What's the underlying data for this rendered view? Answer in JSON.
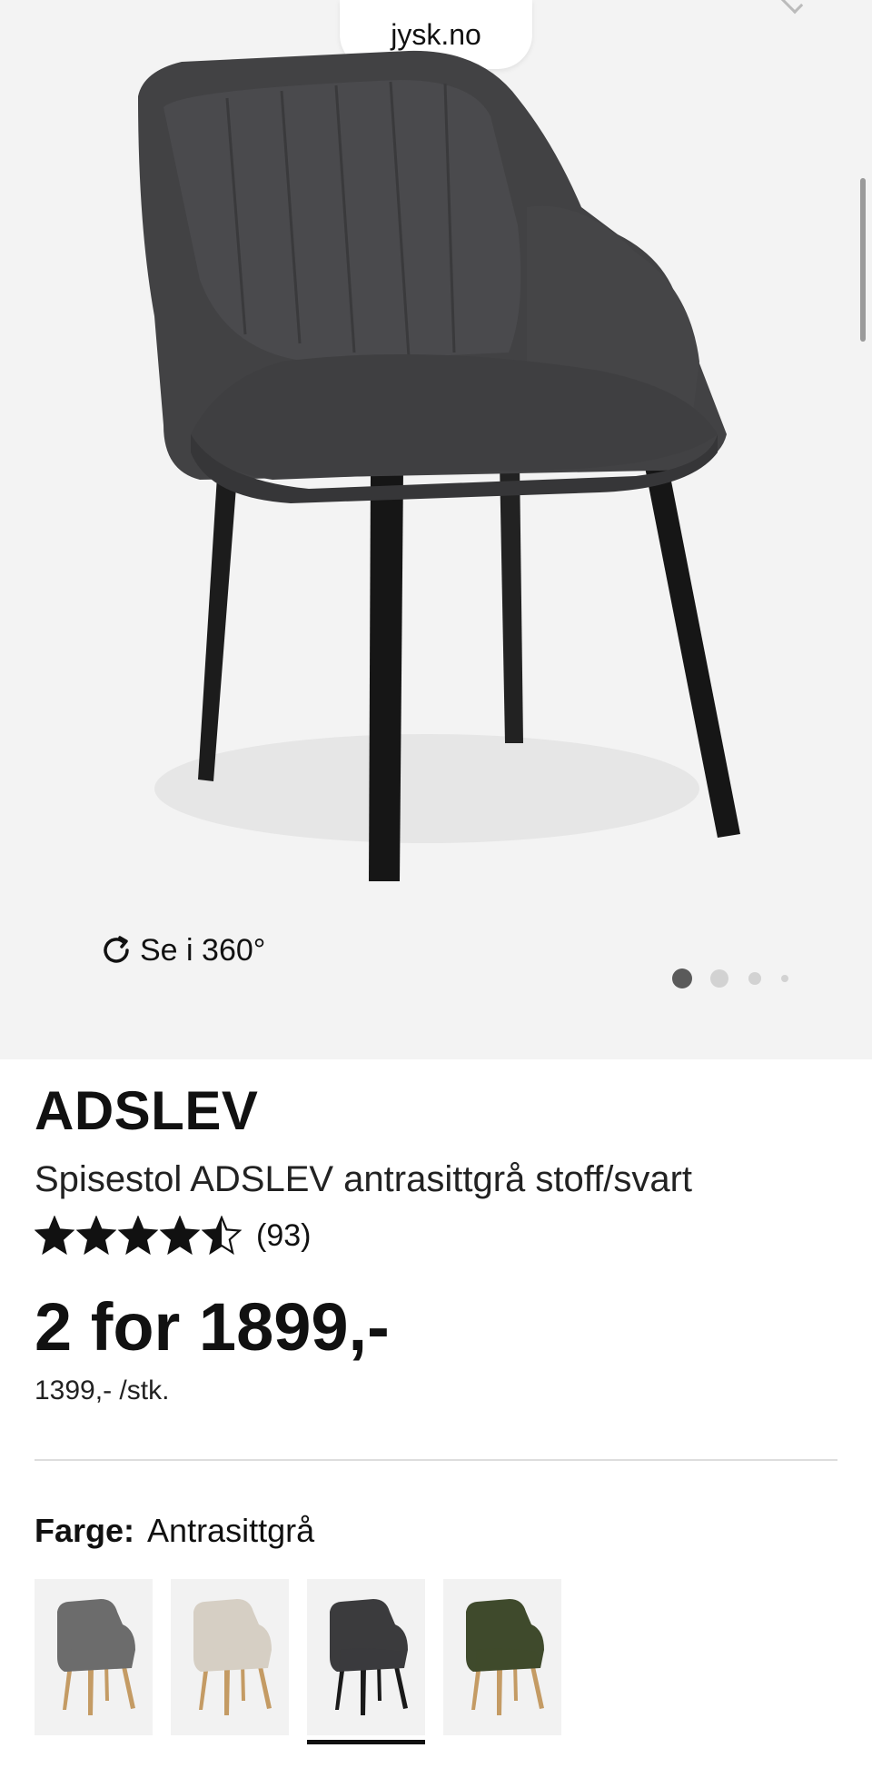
{
  "browser": {
    "url": "jysk.no"
  },
  "gallery": {
    "spin_label": "Se i 360°",
    "dot_count": 4,
    "active_dot": 0
  },
  "product": {
    "brand": "ADSLEV",
    "name": "Spisestol ADSLEV antrasittgrå stoff/svart",
    "rating_value": 4.5,
    "rating_max": 5,
    "review_count": "(93)",
    "price": "2 for 1899,-",
    "unit_price": "1399,- /stk."
  },
  "color": {
    "label": "Farge:",
    "selected": "Antrasittgrå",
    "swatches": [
      {
        "fabric": "#6c6c6c",
        "legs": "#c49b64",
        "selected": false
      },
      {
        "fabric": "#d6cfc4",
        "legs": "#c49b64",
        "selected": false
      },
      {
        "fabric": "#3b3b3d",
        "legs": "#1a1a1a",
        "selected": true
      },
      {
        "fabric": "#3f4a2c",
        "legs": "#c49b64",
        "selected": false
      }
    ]
  },
  "colors": {
    "hero_bg": "#f3f3f3",
    "text": "#111111",
    "star": "#111111"
  }
}
